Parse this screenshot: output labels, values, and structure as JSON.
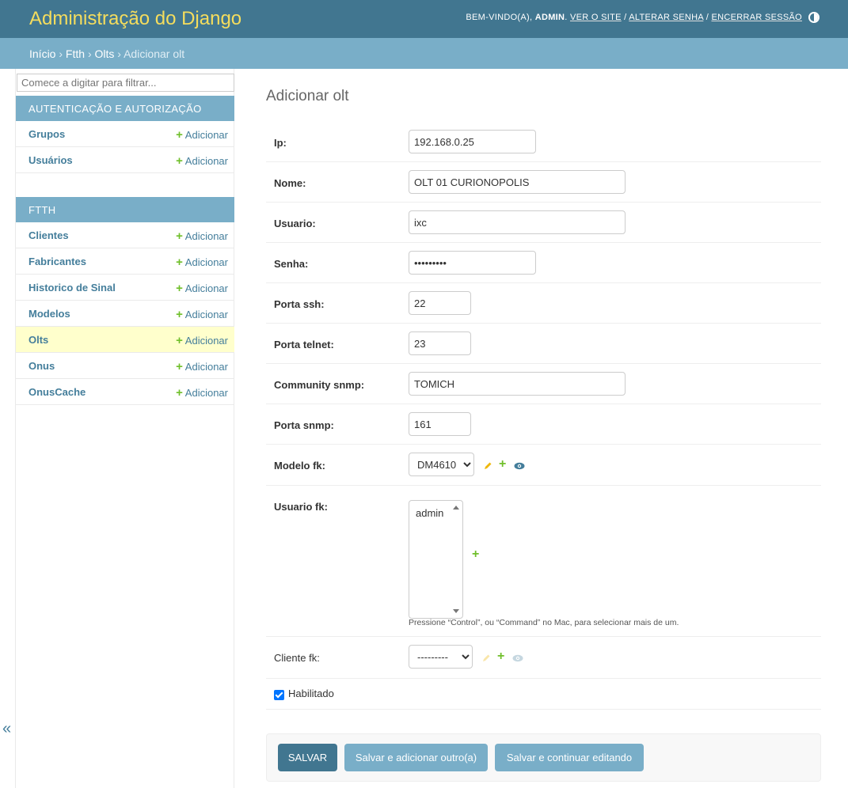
{
  "header": {
    "branding": "Administração do Django",
    "welcome": "BEM-VINDO(A),",
    "username": "ADMIN",
    "links": [
      "VER O SITE",
      "ALTERAR SENHA",
      "ENCERRAR SESSÃO"
    ],
    "separator": "/",
    "colors": {
      "header_bg": "#417690",
      "branding": "#f5dd5d"
    },
    "theme_toggle_icon": "half-circle-icon"
  },
  "breadcrumbs": {
    "items": [
      "Início",
      "Ftth",
      "Olts"
    ],
    "current": "Adicionar olt",
    "separator": "›"
  },
  "sidebar": {
    "filter_placeholder": "Comece a digitar para filtrar...",
    "add_label": "Adicionar",
    "modules": [
      {
        "caption": "AUTENTICAÇÃO E AUTORIZAÇÃO",
        "models": [
          "Grupos",
          "Usuários"
        ]
      },
      {
        "caption": "FTTH",
        "models": [
          "Clientes",
          "Fabricantes",
          "Historico de Sinal",
          "Modelos",
          "Olts",
          "Onus",
          "OnusCache"
        ]
      }
    ],
    "current_model": "Olts",
    "collapse_icon": "«"
  },
  "form": {
    "title": "Adicionar olt",
    "fields": {
      "ip": {
        "label": "Ip:",
        "value": "192.168.0.25"
      },
      "nome": {
        "label": "Nome:",
        "value": "OLT 01 CURIONOPOLIS"
      },
      "usuario": {
        "label": "Usuario:",
        "value": "ixc"
      },
      "senha": {
        "label": "Senha:",
        "value": "•••••••••"
      },
      "porta_ssh": {
        "label": "Porta ssh:",
        "value": "22"
      },
      "porta_telnet": {
        "label": "Porta telnet:",
        "value": "23"
      },
      "community_snmp": {
        "label": "Community snmp:",
        "value": "TOMICH"
      },
      "porta_snmp": {
        "label": "Porta snmp:",
        "value": "161"
      },
      "modelo_fk": {
        "label": "Modelo fk:",
        "value": "DM4610"
      },
      "usuario_fk": {
        "label": "Usuario fk:",
        "options": [
          "admin"
        ],
        "help": "Pressione “Control”, ou “Command” no Mac, para selecionar mais de um."
      },
      "cliente_fk": {
        "label": "Cliente fk:",
        "value": "---------"
      },
      "habilitado": {
        "label": "Habilitado",
        "checked": true
      }
    },
    "buttons": {
      "save": "SALVAR",
      "save_add": "Salvar e adicionar outro(a)",
      "save_continue": "Salvar e continuar editando"
    }
  }
}
